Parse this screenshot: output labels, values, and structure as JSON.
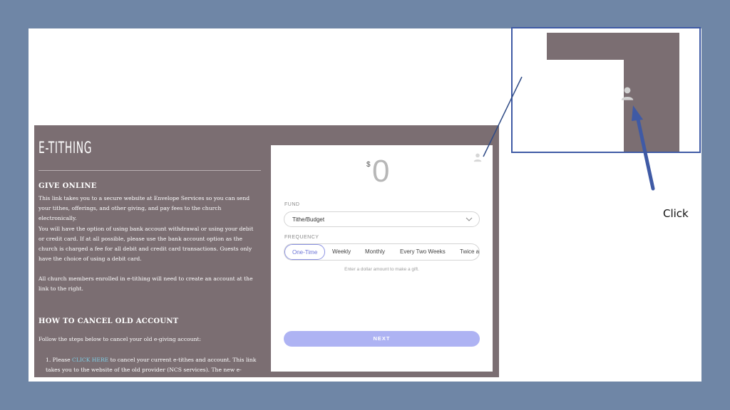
{
  "page": {
    "title": "E-TITHING",
    "give_online_heading": "GIVE ONLINE",
    "give_online_p1": "This link takes you to a secure website at Envelope Services so you can send your tithes, offerings, and other giving, and pay fees to the church electronically.",
    "give_online_p2": "You will have the option of using bank account withdrawal or using your debit or credit card. If at all possible, please use the bank account option as the church is charged a fee for all debit and credit card transactions. Guests only have the choice of using a debit card.",
    "give_online_p3": "All church members enrolled in e-tithing will need to create an account at the link to the right.",
    "cancel_heading": "HOW TO CANCEL OLD ACCOUNT",
    "cancel_intro": "Follow the steps below to cancel your old e-giving account:",
    "step1_prefix": "1. Please",
    "step1_link": "CLICK HERE",
    "step1_suffix": "to cancel your current e-tithes and account. This link takes you to the website of the old provider (NCS services). The new e-giving provider is"
  },
  "form": {
    "currency_symbol": "$",
    "amount": "0",
    "fund_label": "FUND",
    "fund_value": "Tithe/Budget",
    "frequency_label": "FREQUENCY",
    "frequency_options": [
      "One-Time",
      "Weekly",
      "Monthly",
      "Every Two Weeks",
      "Twice a"
    ],
    "hint": "Enter a dollar amount to make a gift.",
    "next_label": "NEXT"
  },
  "annotation": {
    "click_label": "Click"
  },
  "colors": {
    "slide_bg": "#6f86a6",
    "page_bg": "#7b6e72",
    "accent": "#6b73d6",
    "next_button": "#aeb3f3",
    "callout": "#3f5aa5"
  },
  "icons": [
    "user-icon",
    "chevron-down-icon",
    "arrow-icon"
  ]
}
